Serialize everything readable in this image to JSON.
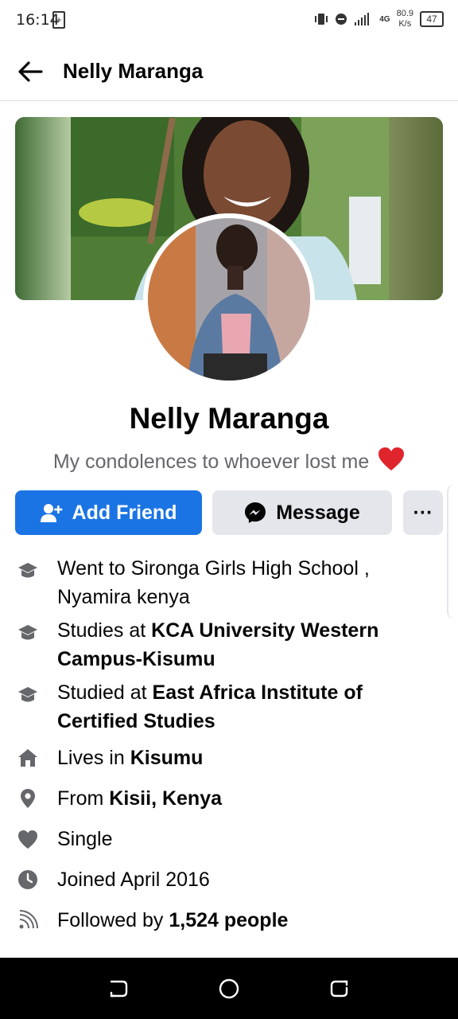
{
  "status_bar": {
    "time": "16:14",
    "network": "4G",
    "speed_value": "80.9",
    "speed_unit": "K/s",
    "battery": "47"
  },
  "header": {
    "title": "Nelly Maranga"
  },
  "profile": {
    "name": "Nelly Maranga",
    "bio": "My condolences to whoever lost me"
  },
  "actions": {
    "add_friend": "Add Friend",
    "message": "Message",
    "more": "···"
  },
  "info": [
    {
      "icon": "graduation-cap-icon",
      "prefix": "Went to Sironga Girls High School , Nyamira kenya",
      "bold": ""
    },
    {
      "icon": "graduation-cap-icon",
      "prefix": "Studies at ",
      "bold": "KCA University Western Campus-Kisumu"
    },
    {
      "icon": "graduation-cap-icon",
      "prefix": "Studied at ",
      "bold": "East Africa Institute of Certified Studies"
    },
    {
      "icon": "home-icon",
      "prefix": "Lives in ",
      "bold": "Kisumu"
    },
    {
      "icon": "location-pin-icon",
      "prefix": "From ",
      "bold": "Kisii, Kenya"
    },
    {
      "icon": "heart-icon",
      "prefix": "Single",
      "bold": ""
    },
    {
      "icon": "clock-icon",
      "prefix": "Joined April 2016",
      "bold": ""
    },
    {
      "icon": "rss-icon",
      "prefix": "Followed by ",
      "bold": "1,524 people"
    }
  ],
  "colors": {
    "primary": "#1b74e4",
    "secondary_button": "#e4e6eb",
    "muted_text": "#65676b",
    "icon": "#65676b"
  }
}
